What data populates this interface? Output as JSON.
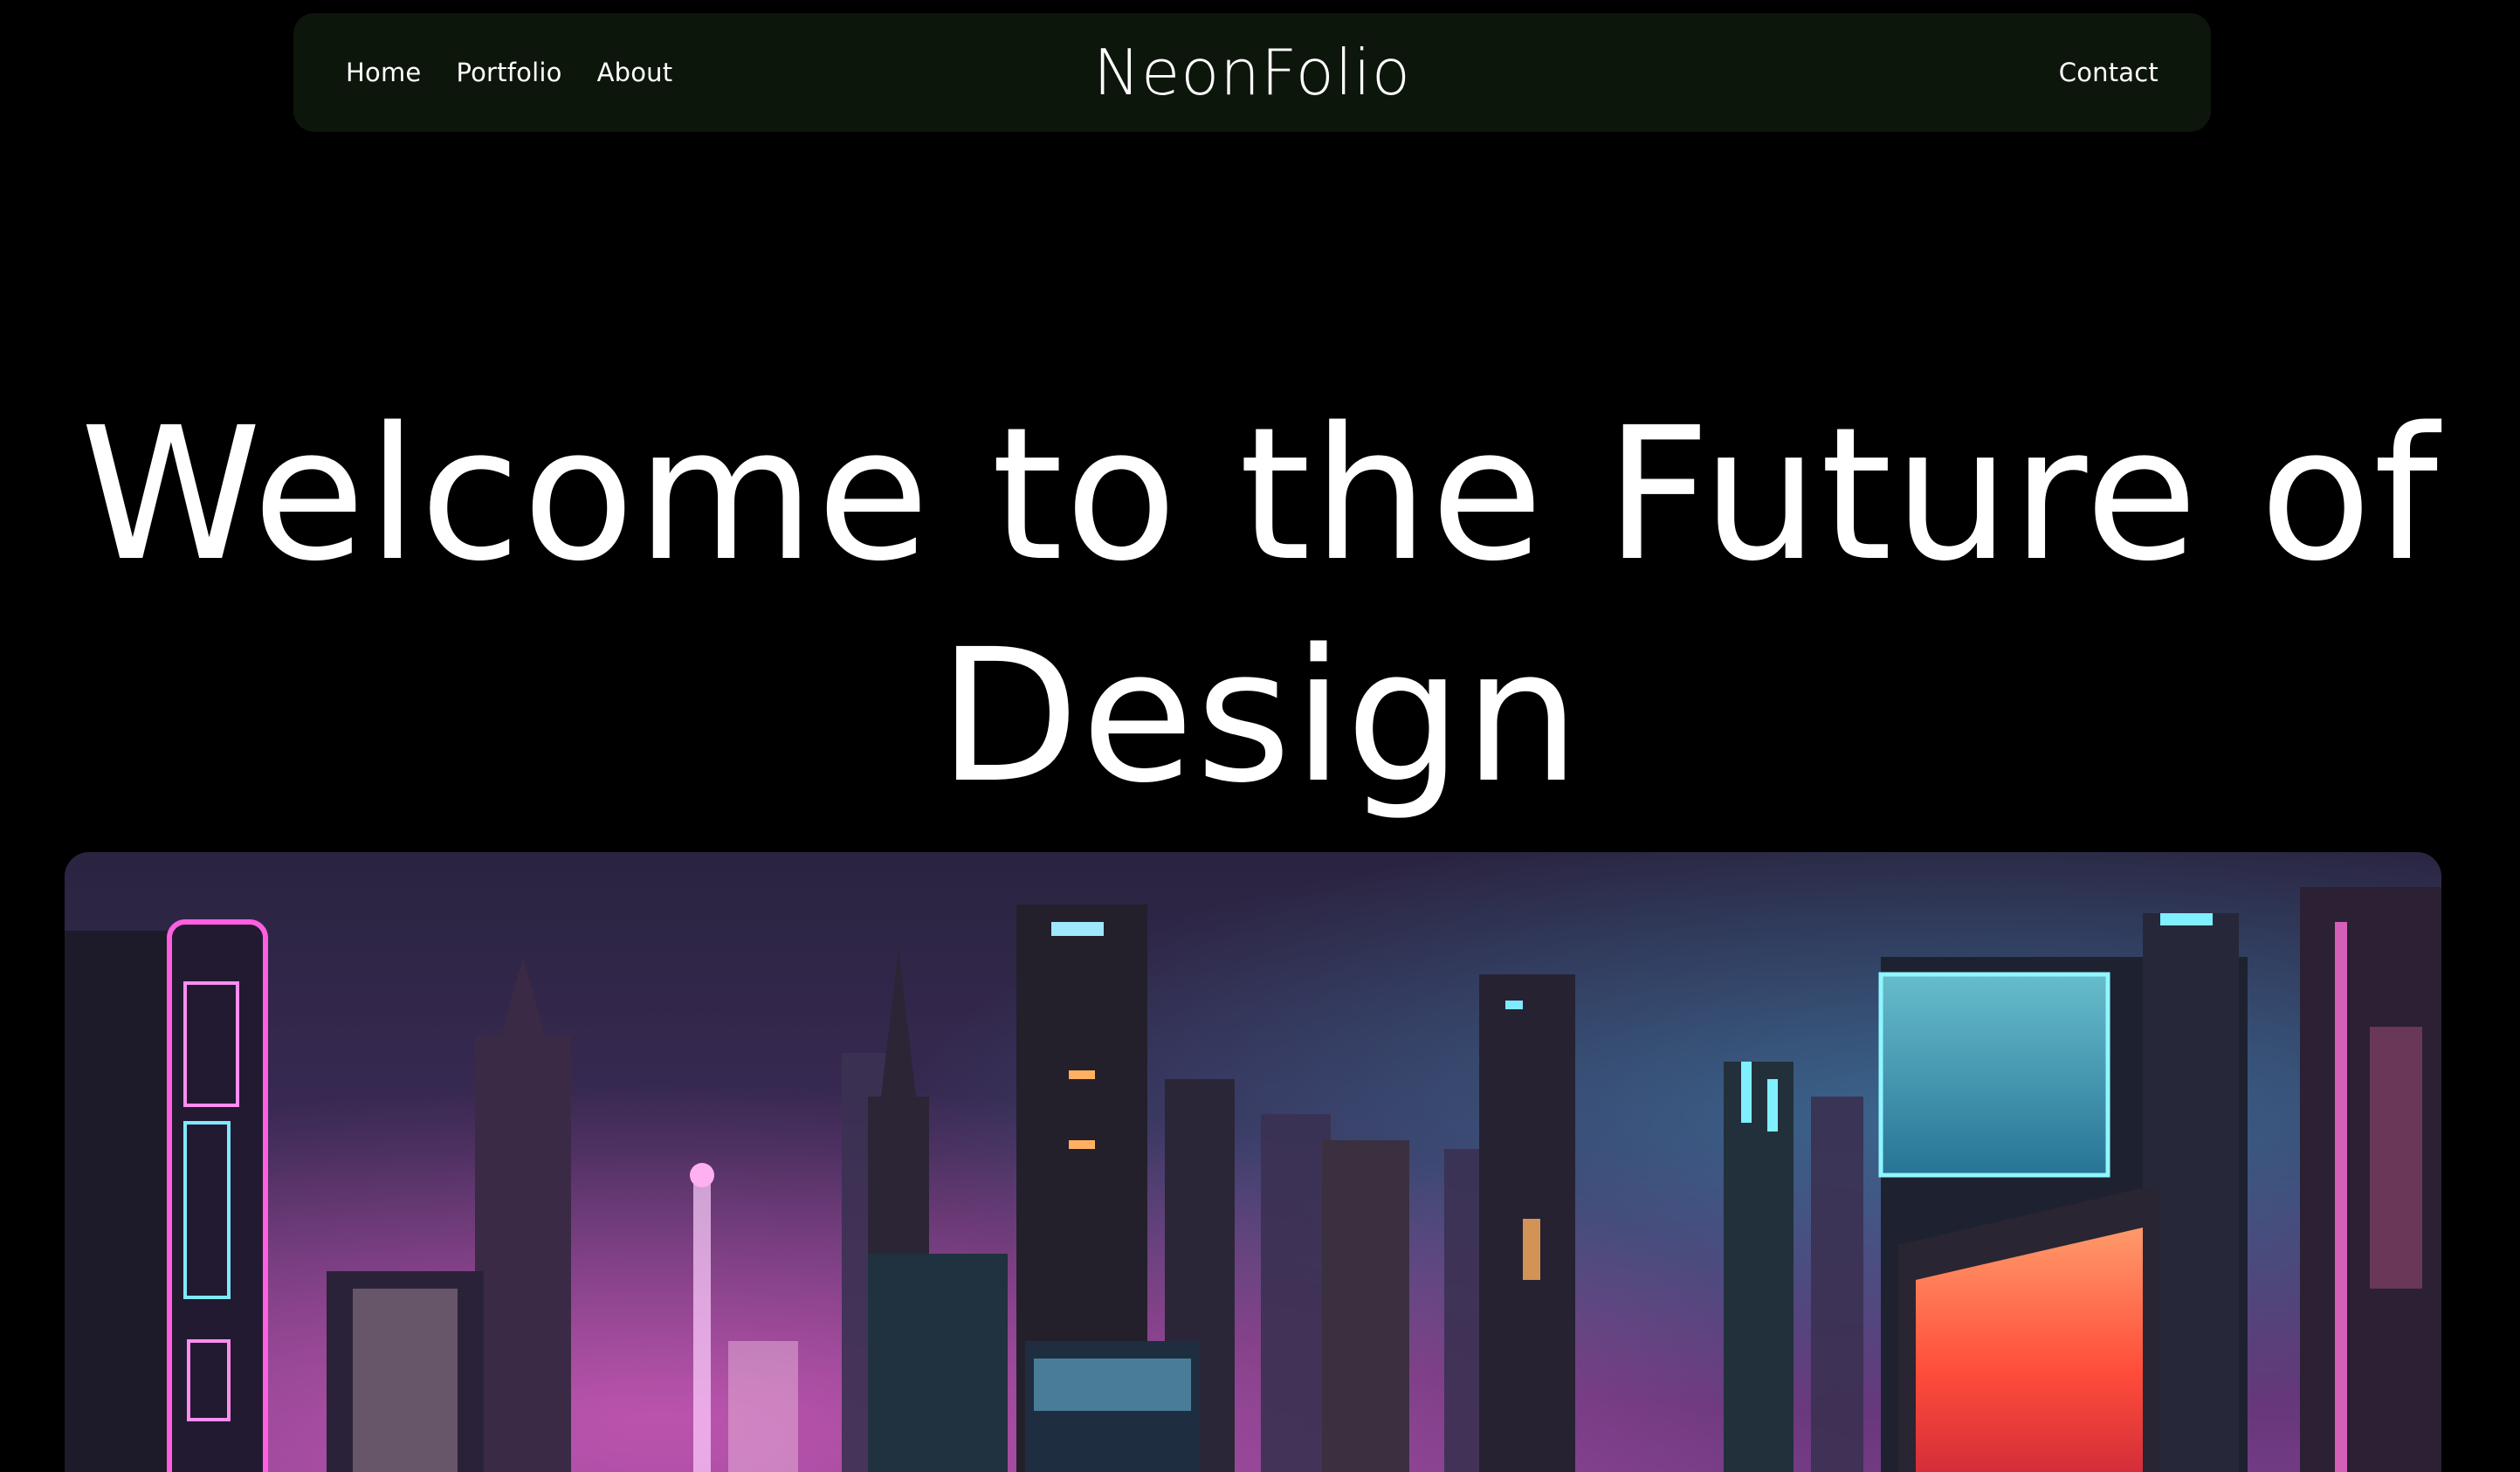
{
  "nav": {
    "links_left": [
      "Home",
      "Portfolio",
      "About"
    ],
    "brand": "NeonFolio",
    "contact": "Contact"
  },
  "hero": {
    "title": "Welcome to the Future of Design",
    "image_subject": "neon-city-skyline"
  },
  "colors": {
    "page_background": "#000000",
    "navbar_background": "#0d160a",
    "text": "#ffffff",
    "neon_pink": "#ff4fd8",
    "neon_cyan": "#4fe3ff",
    "neon_orange": "#ff6a3d"
  }
}
